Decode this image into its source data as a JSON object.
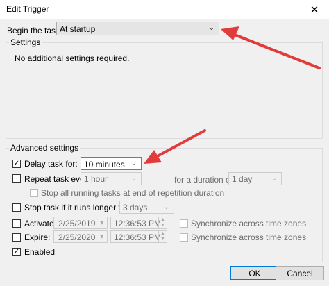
{
  "window": {
    "title": "Edit Trigger",
    "close_glyph": "✕"
  },
  "begin": {
    "label": "Begin the task:",
    "value": "At startup"
  },
  "settings": {
    "legend": "Settings",
    "message": "No additional settings required."
  },
  "advanced": {
    "legend": "Advanced settings",
    "delay": {
      "label": "Delay task for:",
      "checked": true,
      "value": "10 minutes"
    },
    "repeat": {
      "label": "Repeat task every:",
      "checked": false,
      "value": "1 hour",
      "duration_label": "for a duration of:",
      "duration_value": "1 day"
    },
    "stop_running": {
      "label": "Stop all running tasks at end of repetition duration",
      "checked": false
    },
    "stop_longer": {
      "label": "Stop task if it runs longer than:",
      "checked": false,
      "value": "3 days"
    },
    "activate": {
      "label": "Activate:",
      "checked": false,
      "date": "2/25/2019",
      "time": "12:36:53 PM",
      "sync_label": "Synchronize across time zones"
    },
    "expire": {
      "label": "Expire:",
      "checked": false,
      "date": "2/25/2020",
      "time": "12:36:53 PM",
      "sync_label": "Synchronize across time zones"
    },
    "enabled": {
      "label": "Enabled",
      "checked": true
    }
  },
  "buttons": {
    "ok": "OK",
    "cancel": "Cancel"
  },
  "colors": {
    "annotation_arrow": "#e03c3c",
    "default_button_border": "#0078d7"
  },
  "icons": {
    "check": "✓",
    "chevron": "⌄"
  }
}
